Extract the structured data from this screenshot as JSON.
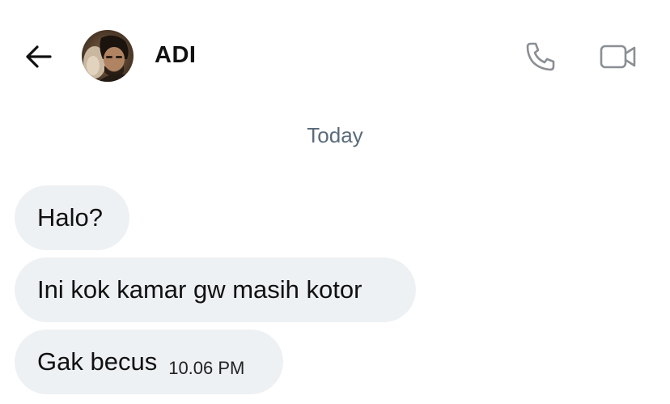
{
  "header": {
    "contact_name": "ADI",
    "back_icon": "arrow-left-icon",
    "call_icon": "phone-icon",
    "video_icon": "video-camera-icon"
  },
  "chat": {
    "date_separator": "Today",
    "messages": [
      {
        "text": "Halo?"
      },
      {
        "text": "Ini kok kamar gw masih kotor"
      },
      {
        "text": "Gak becus",
        "time": "10.06 PM"
      }
    ]
  },
  "colors": {
    "bubble_bg": "#eef1f3",
    "icon_gray": "#8a8f94",
    "date_text": "#5b6b7a"
  }
}
